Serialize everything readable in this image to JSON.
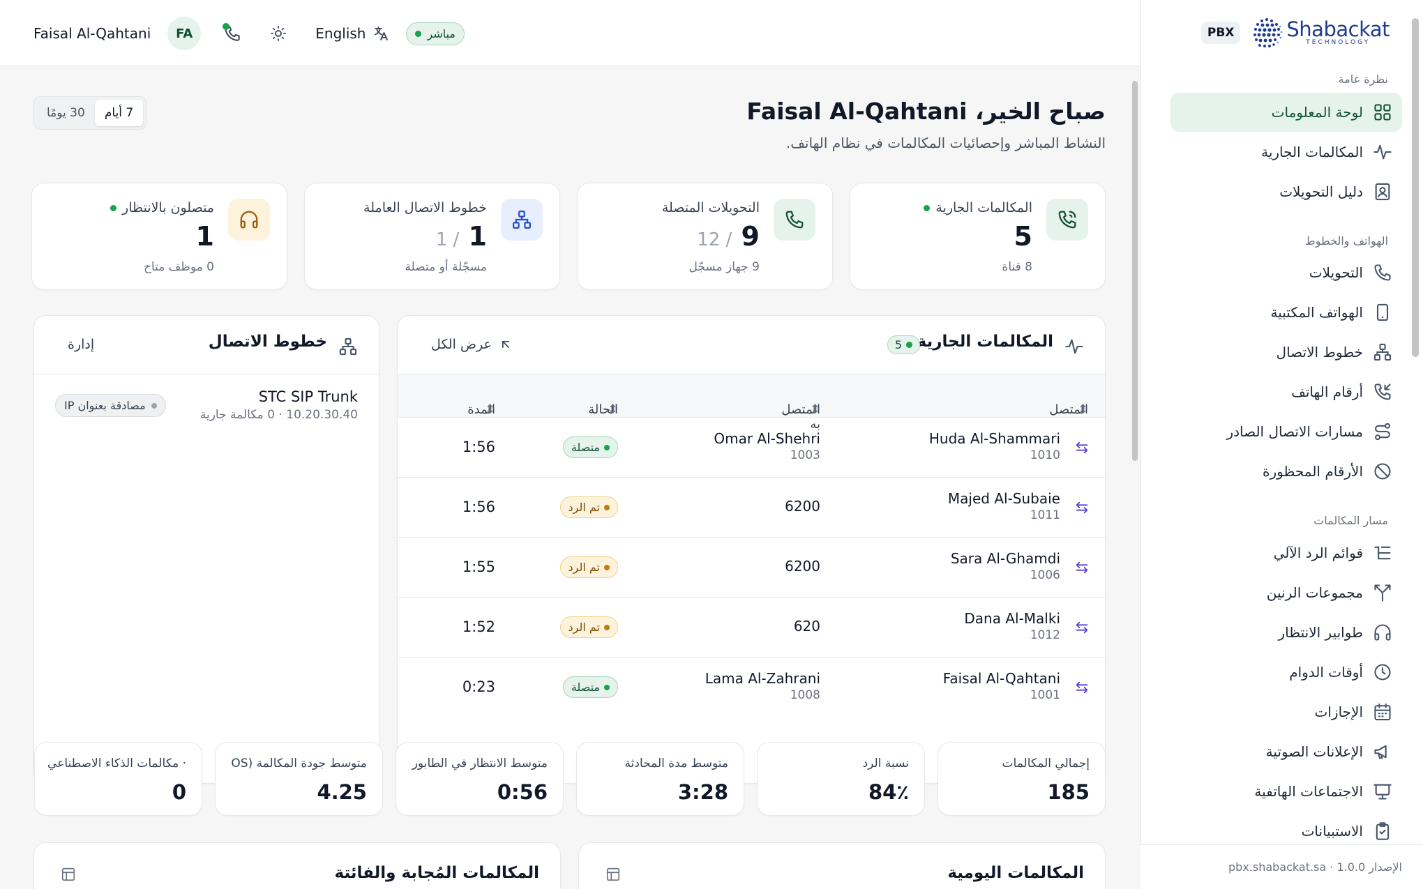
{
  "topbar": {
    "user_name": "Faisal Al-Qahtani",
    "avatar_initials": "FA",
    "language": "English",
    "live_label": "مباشر"
  },
  "sidebar": {
    "pbx_badge": "PBX",
    "logo_main": "Shabackat",
    "logo_sub": "TECHNOLOGY",
    "sections": {
      "overview": "نظرة عامة",
      "phones": "الهواتف والخطوط",
      "routing": "مسار المكالمات"
    },
    "items": [
      {
        "label": "لوحة المعلومات",
        "icon": "dashboard-icon"
      },
      {
        "label": "المكالمات الجارية",
        "icon": "activity-icon"
      },
      {
        "label": "دليل التحويلات",
        "icon": "contacts-book-icon"
      },
      {
        "label": "التحويلات",
        "icon": "phone-icon"
      },
      {
        "label": "الهواتف المكتبية",
        "icon": "desk-phone-icon"
      },
      {
        "label": "خطوط الاتصال",
        "icon": "network-icon"
      },
      {
        "label": "أرقام الهاتف",
        "icon": "phone-incoming-icon"
      },
      {
        "label": "مسارات الاتصال الصادر",
        "icon": "route-icon"
      },
      {
        "label": "الأرقام المحظورة",
        "icon": "ban-icon"
      },
      {
        "label": "قوائم الرد الآلي",
        "icon": "list-tree-icon"
      },
      {
        "label": "مجموعات الرنين",
        "icon": "split-icon"
      },
      {
        "label": "طوابير الانتظار",
        "icon": "headphones-icon"
      },
      {
        "label": "أوقات الدوام",
        "icon": "clock-icon"
      },
      {
        "label": "الإجازات",
        "icon": "calendar-icon"
      },
      {
        "label": "الإعلانات الصوتية",
        "icon": "megaphone-icon"
      },
      {
        "label": "الاجتماعات الهاتفية",
        "icon": "presentation-icon"
      },
      {
        "label": "الاستبيانات",
        "icon": "clipboard-check-icon"
      }
    ],
    "footer": "الإصدار 1.0.0 · pbx.shabackat.sa"
  },
  "header": {
    "title": "صباح الخير، Faisal Al-Qahtani",
    "subtitle": "النشاط المباشر وإحصائيات المكالمات في نظام الهاتف.",
    "period": [
      "7 أيام",
      "30 يومًا"
    ]
  },
  "stats": [
    {
      "label": "المكالمات الجارية",
      "value": "5",
      "denominator": "",
      "sub": "8 قناة",
      "live": true
    },
    {
      "label": "التحويلات المتصلة",
      "value": "9",
      "denominator": "/ 12",
      "sub": "9 جهاز مسجّل",
      "live": false
    },
    {
      "label": "خطوط الاتصال العاملة",
      "value": "1",
      "denominator": "/ 1",
      "sub": "مسجّلة أو متصلة",
      "live": false
    },
    {
      "label": "متصلون بالانتظار",
      "value": "1",
      "denominator": "",
      "sub": "0 موظف متاح",
      "live": true
    }
  ],
  "active_calls": {
    "title": "المكالمات الجارية",
    "count": "5",
    "view_all": "عرض الكل",
    "columns": [
      "المتصل",
      "المتصل به",
      "الحالة",
      "المدة"
    ],
    "rows": [
      {
        "caller": "Huda Al-Shammari",
        "caller_ext": "1010",
        "callee": "Omar Al-Shehri",
        "callee_ext": "1003",
        "status": "متصلة",
        "tone": "green",
        "duration": "1:56"
      },
      {
        "caller": "Majed Al-Subaie",
        "caller_ext": "1011",
        "callee": "6200",
        "callee_ext": "",
        "status": "تم الرد",
        "tone": "amber",
        "duration": "1:56"
      },
      {
        "caller": "Sara Al-Ghamdi",
        "caller_ext": "1006",
        "callee": "6200",
        "callee_ext": "",
        "status": "تم الرد",
        "tone": "amber",
        "duration": "1:55"
      },
      {
        "caller": "Dana Al-Malki",
        "caller_ext": "1012",
        "callee": "620",
        "callee_ext": "",
        "status": "تم الرد",
        "tone": "amber",
        "duration": "1:52"
      },
      {
        "caller": "Faisal Al-Qahtani",
        "caller_ext": "1001",
        "callee": "Lama Al-Zahrani",
        "callee_ext": "1008",
        "status": "متصلة",
        "tone": "green",
        "duration": "0:23"
      }
    ]
  },
  "trunks": {
    "title": "خطوط الاتصال",
    "manage": "إدارة",
    "items": [
      {
        "name": "STC SIP Trunk",
        "detail": "10.20.30.40 · 0 مكالمة جارية",
        "auth": "مصادقة بعنوان IP"
      }
    ]
  },
  "metrics": [
    {
      "label": "إجمالي المكالمات",
      "value": "185"
    },
    {
      "label": "نسبة الرد",
      "value": "84٪"
    },
    {
      "label": "متوسط مدة المحادثة",
      "value": "3:28"
    },
    {
      "label": "متوسط الانتظار في الطابور",
      "value": "0:56"
    },
    {
      "label": "متوسط جودة المكالمة (OS",
      "value": "4.25"
    },
    {
      "label": "· مكالمات الذكاء الاصطناعي",
      "value": "0"
    }
  ],
  "bottom": {
    "daily_title": "المكالمات اليومية",
    "answered_title": "المكالمات المُجابة والفائتة"
  },
  "colors": {
    "accent_green": "#16a34a",
    "active_bg": "#e6f2ec",
    "amber": "#c27c0e",
    "transfer_purple": "#5b3fd6"
  }
}
